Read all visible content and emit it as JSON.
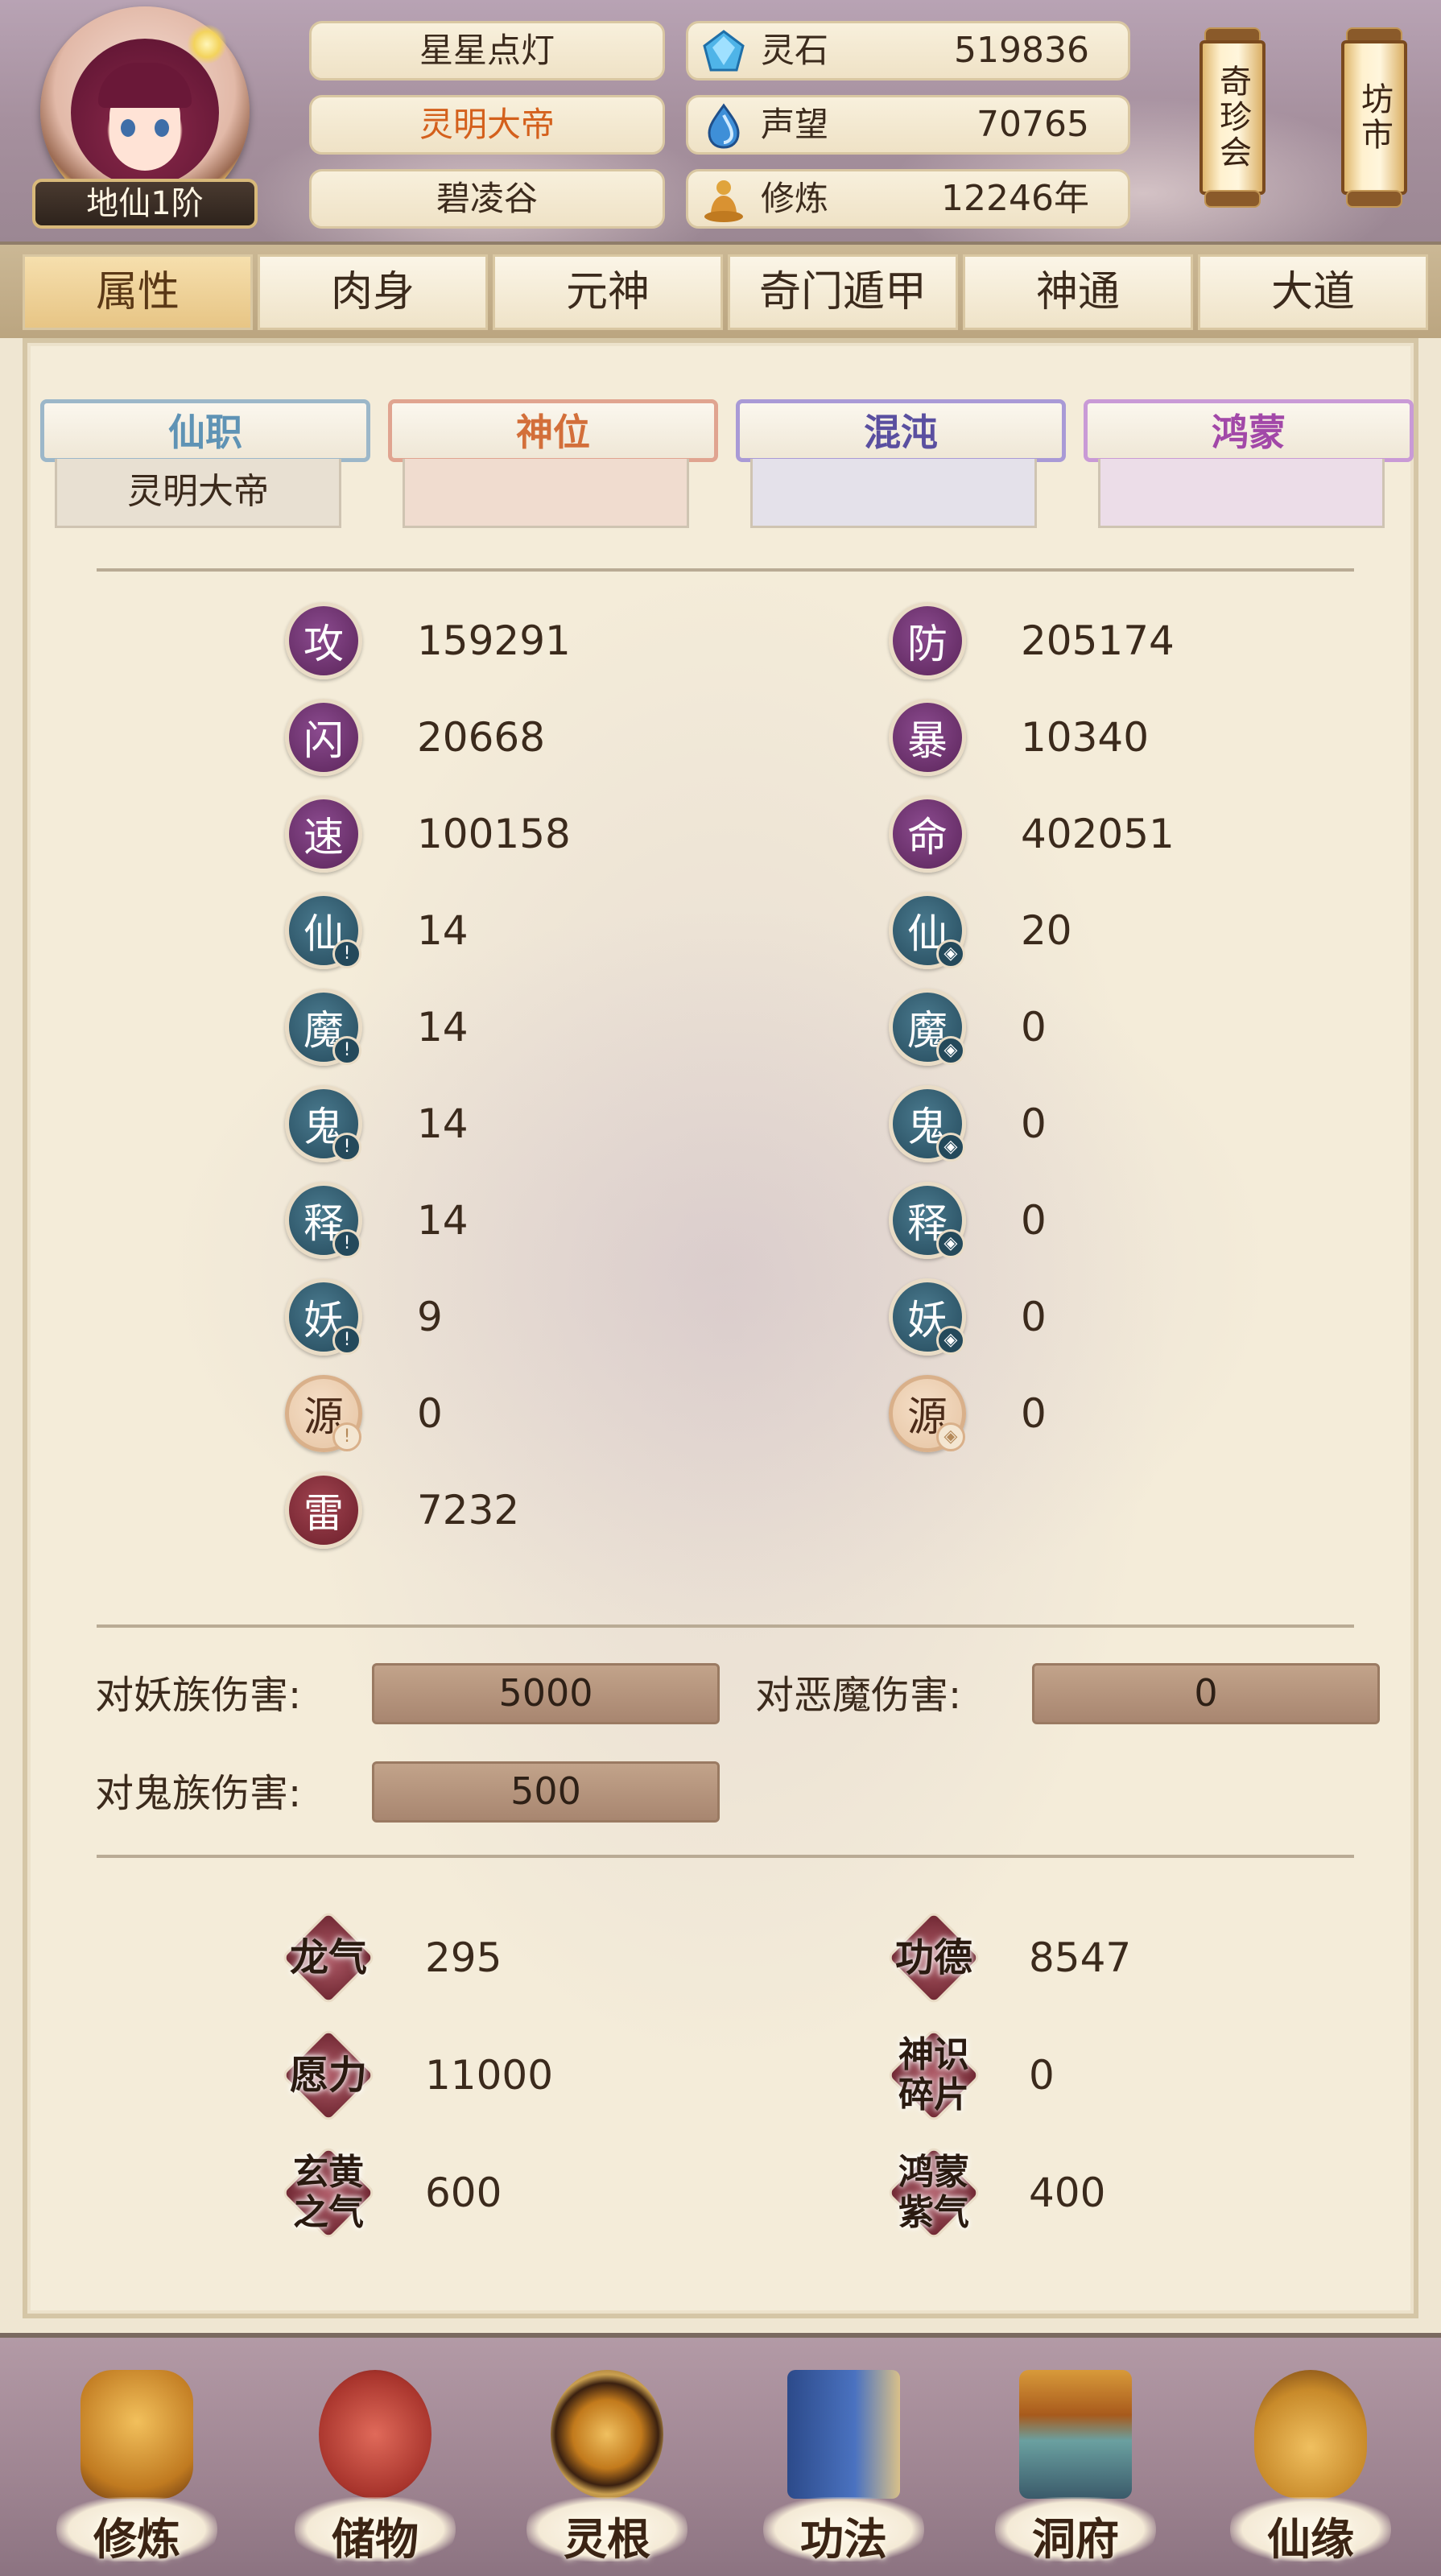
{
  "header": {
    "rank_badge": "地仙1阶",
    "name_plates": [
      "星星点灯",
      "灵明大帝",
      "碧凌谷"
    ],
    "resources": [
      {
        "label": "灵石",
        "value": "519836",
        "icon": "spirit-stone-icon"
      },
      {
        "label": "声望",
        "value": "70765",
        "icon": "prestige-icon"
      },
      {
        "label": "修炼",
        "value": "12246年",
        "icon": "meditation-icon"
      }
    ],
    "scroll_buttons": [
      "奇珍会",
      "坊市"
    ]
  },
  "tabs": [
    "属性",
    "肉身",
    "元神",
    "奇门遁甲",
    "神通",
    "大道"
  ],
  "active_tab": "属性",
  "subtabs": [
    {
      "label": "仙职",
      "value": "灵明大帝"
    },
    {
      "label": "神位",
      "value": ""
    },
    {
      "label": "混沌",
      "value": ""
    },
    {
      "label": "鸿蒙",
      "value": ""
    }
  ],
  "stats_left": [
    {
      "icon": "攻",
      "value": "159291",
      "style": "purple"
    },
    {
      "icon": "闪",
      "value": "20668",
      "style": "purple"
    },
    {
      "icon": "速",
      "value": "100158",
      "style": "purple"
    },
    {
      "icon": "仙",
      "value": "14",
      "style": "teal"
    },
    {
      "icon": "魔",
      "value": "14",
      "style": "teal"
    },
    {
      "icon": "鬼",
      "value": "14",
      "style": "teal"
    },
    {
      "icon": "释",
      "value": "14",
      "style": "teal"
    },
    {
      "icon": "妖",
      "value": "9",
      "style": "teal"
    },
    {
      "icon": "源",
      "value": "0",
      "style": "tan"
    },
    {
      "icon": "雷",
      "value": "7232",
      "style": "red"
    }
  ],
  "stats_right": [
    {
      "icon": "防",
      "value": "205174",
      "style": "purple"
    },
    {
      "icon": "暴",
      "value": "10340",
      "style": "purple"
    },
    {
      "icon": "命",
      "value": "402051",
      "style": "purple"
    },
    {
      "icon": "仙",
      "value": "20",
      "style": "teal"
    },
    {
      "icon": "魔",
      "value": "0",
      "style": "teal"
    },
    {
      "icon": "鬼",
      "value": "0",
      "style": "teal"
    },
    {
      "icon": "释",
      "value": "0",
      "style": "teal"
    },
    {
      "icon": "妖",
      "value": "0",
      "style": "teal"
    },
    {
      "icon": "源",
      "value": "0",
      "style": "tan"
    }
  ],
  "damage": {
    "yao_label": "对妖族伤害:",
    "yao_value": "5000",
    "emo_label": "对恶魔伤害:",
    "emo_value": "0",
    "gui_label": "对鬼族伤害:",
    "gui_value": "500"
  },
  "special": [
    {
      "label": "龙气",
      "value": "295"
    },
    {
      "label": "功德",
      "value": "8547"
    },
    {
      "label": "愿力",
      "value": "11000"
    },
    {
      "label": "神识碎片",
      "value": "0"
    },
    {
      "label": "玄黄之气",
      "value": "600"
    },
    {
      "label": "鸿蒙紫气",
      "value": "400"
    }
  ],
  "bottom_nav": [
    "修炼",
    "储物",
    "灵根",
    "功法",
    "洞府",
    "仙缘"
  ],
  "colors": {
    "active_tab": "#e7c585",
    "stat_purple": "#5a2459",
    "stat_teal": "#24495b",
    "stat_red": "#6b1e2a",
    "highlight_name": "#d4601c"
  }
}
